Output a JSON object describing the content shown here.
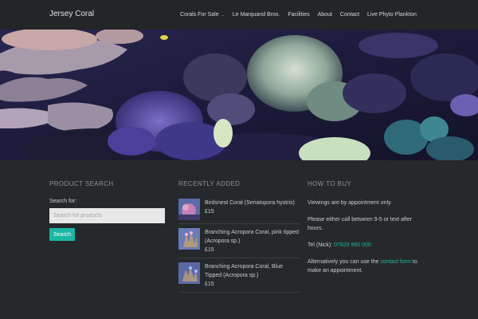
{
  "site": {
    "brand": "Jersey Coral"
  },
  "nav": {
    "items": [
      {
        "label": "Corals For Sale",
        "has_dropdown": true
      },
      {
        "label": "Le Marquand Bros.",
        "has_dropdown": false
      },
      {
        "label": "Facilities",
        "has_dropdown": false
      },
      {
        "label": "About",
        "has_dropdown": false
      },
      {
        "label": "Contact",
        "has_dropdown": false
      },
      {
        "label": "Live Phyto Plankton",
        "has_dropdown": false
      }
    ],
    "caret": "⌄"
  },
  "product_search": {
    "title": "PRODUCT SEARCH",
    "label": "Search for:",
    "placeholder": "Search for products",
    "button": "Search"
  },
  "recently_added": {
    "title": "RECENTLY ADDED",
    "products": [
      {
        "name": "Birdsnest Coral (Seriatopora hystrix)",
        "price": "£15"
      },
      {
        "name": "Branching Acropora Coral, pink tipped (Acropora sp.)",
        "price": "£15"
      },
      {
        "name": "Branching Acropora Coral, Blue Tipped (Acropora sp.)",
        "price": "£15"
      }
    ]
  },
  "how_to_buy": {
    "title": "HOW TO BUY",
    "p1": "Viewings are by appointment only.",
    "p2": "Please either call between 9-5 or text after hours.",
    "tel_prefix": "Tel (Nick): ",
    "tel_number": "07829 960 000",
    "p4_before": "Alternatively you can use the ",
    "p4_link": "contact form",
    "p4_after": " to make an appointment."
  },
  "colors": {
    "accent": "#1bb7a4",
    "topbar": "#232526",
    "background": "#26292b"
  }
}
